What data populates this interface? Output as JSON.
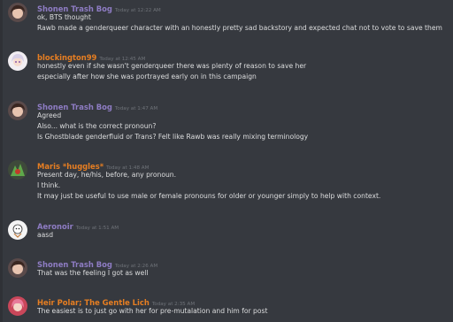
{
  "colors": {
    "background": "#36393f",
    "text": "#dcddde",
    "timestamp": "#6f7379",
    "purple_name": "#8e7cc3",
    "orange_name": "#e67e22"
  },
  "messages": [
    {
      "author": "Shonen Trash Bog",
      "author_color": "#8e7cc3",
      "timestamp": "Today at 12:22 AM",
      "avatar_icon": "brown-haired-character-avatar-icon",
      "lines": [
        "ok, BTS thought",
        "Rawb made a genderqueer character with an honestly pretty sad backstory and expected chat not to vote to save them"
      ]
    },
    {
      "author": "blockington99",
      "author_color": "#e67e22",
      "timestamp": "Today at 12:45 AM",
      "avatar_icon": "white-haired-anime-avatar-icon",
      "lines": [
        "honestly even if she wasn't genderqueer there was plenty of reason to save her",
        "especially after how she was portrayed early on in this campaign"
      ]
    },
    {
      "author": "Shonen Trash Bog",
      "author_color": "#8e7cc3",
      "timestamp": "Today at 1:47 AM",
      "avatar_icon": "brown-haired-character-avatar-icon",
      "lines": [
        "Agreed",
        "Also... what is the correct pronoun?",
        "Is Ghostblade genderfluid or Trans? Felt like Rawb was really mixing terminology"
      ]
    },
    {
      "author": "Maris *huggles*",
      "author_color": "#e67e22",
      "timestamp": "Today at 1:48 AM",
      "avatar_icon": "green-character-avatar-icon",
      "lines": [
        "Present day, he/his, before, any pronoun.",
        "I think.",
        "It may just be useful to use male or female pronouns for older or younger simply to help with context."
      ]
    },
    {
      "author": "Aeronoir",
      "author_color": "#8e7cc3",
      "timestamp": "Today at 1:51 AM",
      "avatar_icon": "white-cartoon-avatar-icon",
      "lines": [
        "aasd"
      ]
    },
    {
      "author": "Shonen Trash Bog",
      "author_color": "#8e7cc3",
      "timestamp": "Today at 2:26 AM",
      "avatar_icon": "brown-haired-character-avatar-icon",
      "lines": [
        "That was the feeling I got as well"
      ]
    },
    {
      "author": "Heir Polar; The Gentle Lich",
      "author_color": "#e67e22",
      "timestamp": "Today at 2:35 AM",
      "avatar_icon": "pink-haired-character-avatar-icon",
      "lines": [
        "The easiest is to just go with her for pre-mutalation and him for post"
      ]
    }
  ]
}
